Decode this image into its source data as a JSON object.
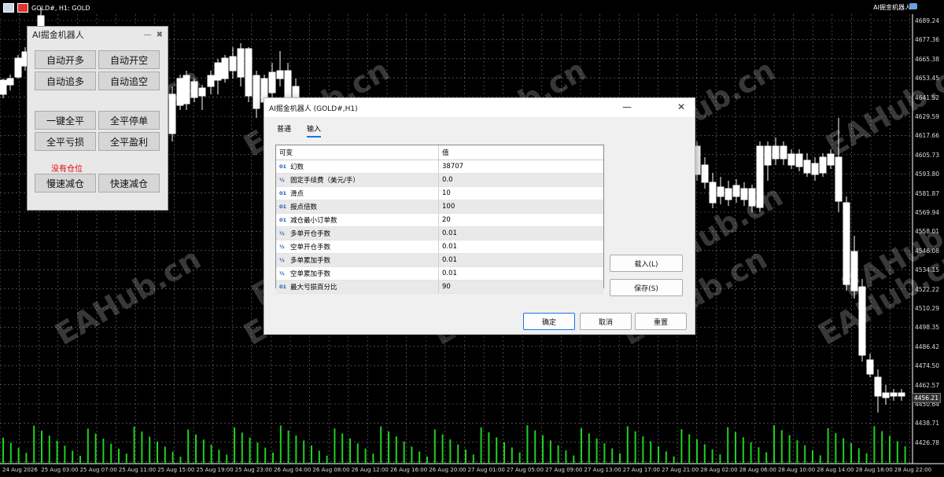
{
  "window": {
    "title": "GOLD#, H1:  GOLD",
    "robot_name": "AI掘金机器人"
  },
  "price_axis": [
    "4689.24",
    "4677.36",
    "4665.38",
    "4653.45",
    "4641.52",
    "4629.59",
    "4617.66",
    "4605.73",
    "4593.80",
    "4581.87",
    "4569.94",
    "4558.01",
    "4546.08",
    "4534.15",
    "4522.22",
    "4510.29",
    "4498.35",
    "4486.42",
    "4474.50",
    "4462.57",
    "4450.64",
    "4438.71",
    "4426.78"
  ],
  "current_price": "4456.21",
  "time_axis": [
    "24 Aug 2026",
    "25 Aug 03:00",
    "25 Aug 07:00",
    "25 Aug 11:00",
    "25 Aug 15:00",
    "25 Aug 19:00",
    "25 Aug 23:00",
    "26 Aug 04:00",
    "26 Aug 08:00",
    "26 Aug 12:00",
    "26 Aug 16:00",
    "26 Aug 20:00",
    "27 Aug 01:00",
    "27 Aug 05:00",
    "27 Aug 09:00",
    "27 Aug 13:00",
    "27 Aug 17:00",
    "27 Aug 21:00",
    "28 Aug 02:00",
    "28 Aug 06:00",
    "28 Aug 10:00",
    "28 Aug 14:00",
    "28 Aug 18:00",
    "28 Aug 22:00"
  ],
  "watermark": "EAHub.cn",
  "panel": {
    "title": "AI掘金机器人",
    "minimize": "—",
    "close": "✖",
    "buttons": [
      "自动开多",
      "自动开空",
      "自动追多",
      "自动追空",
      "一键全平",
      "全平停单",
      "全平亏损",
      "全平盈利",
      "慢速减仓",
      "快速减仓"
    ],
    "status": "没有仓位"
  },
  "dialog": {
    "title": "AI掘金机器人 (GOLD#,H1)",
    "minimize": "—",
    "close": "✕",
    "tabs": [
      "普通",
      "输入"
    ],
    "active_tab": "输入",
    "col_var": "可变",
    "col_val": "值",
    "params": [
      {
        "type": "01",
        "name": "幻数",
        "value": "38707"
      },
      {
        "type": "½",
        "name": "固定手续费（美元/手）",
        "value": "0.0"
      },
      {
        "type": "01",
        "name": "滑点",
        "value": "10"
      },
      {
        "type": "01",
        "name": "报点倍数",
        "value": "100"
      },
      {
        "type": "01",
        "name": "减仓最小订单数",
        "value": "20"
      },
      {
        "type": "½",
        "name": "多单开仓手数",
        "value": "0.01"
      },
      {
        "type": "½",
        "name": "空单开仓手数",
        "value": "0.01"
      },
      {
        "type": "½",
        "name": "多单累加手数",
        "value": "0.01"
      },
      {
        "type": "½",
        "name": "空单累加手数",
        "value": "0.01"
      },
      {
        "type": "01",
        "name": "最大亏损百分比",
        "value": "90"
      }
    ],
    "load": "载入(L)",
    "save": "保存(S)",
    "ok": "确定",
    "cancel": "取消",
    "reset": "重置"
  }
}
